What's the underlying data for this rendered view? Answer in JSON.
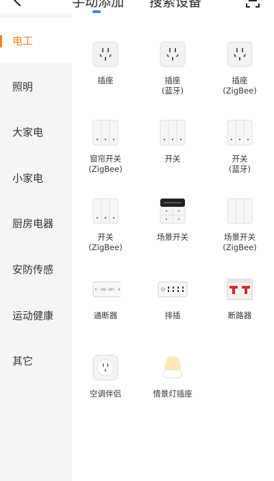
{
  "header": {
    "tabs": [
      {
        "label": "手动添加",
        "active": true
      },
      {
        "label": "搜索设备",
        "active": false
      }
    ],
    "accent_color": "#3b82f6"
  },
  "sidebar": {
    "active_color": "#f5821f",
    "items": [
      {
        "label": "电工",
        "active": true
      },
      {
        "label": "照明"
      },
      {
        "label": "大家电"
      },
      {
        "label": "小家电"
      },
      {
        "label": "厨房电器"
      },
      {
        "label": "安防传感"
      },
      {
        "label": "运动健康"
      },
      {
        "label": "其它"
      }
    ]
  },
  "devices": [
    {
      "line1": "插座",
      "line2": "",
      "icon": "socket-icon"
    },
    {
      "line1": "插座",
      "line2": "(蓝牙)",
      "icon": "socket-icon"
    },
    {
      "line1": "插座",
      "line2": "(ZigBee)",
      "icon": "socket-icon"
    },
    {
      "line1": "窗帘开关",
      "line2": "(ZigBee)",
      "icon": "curtain-switch-icon"
    },
    {
      "line1": "开关",
      "line2": "",
      "icon": "switch-icon"
    },
    {
      "line1": "开关",
      "line2": "(蓝牙)",
      "icon": "switch-icon"
    },
    {
      "line1": "开关",
      "line2": "(ZigBee)",
      "icon": "switch-icon"
    },
    {
      "line1": "场景开关",
      "line2": "",
      "icon": "scene-switch-icon"
    },
    {
      "line1": "场景开关",
      "line2": "(ZigBee)",
      "icon": "scene-switch-icon"
    },
    {
      "line1": "通断器",
      "line2": "",
      "icon": "relay-icon",
      "icon_text": "ON · OFF"
    },
    {
      "line1": "排插",
      "line2": "",
      "icon": "power-strip-icon"
    },
    {
      "line1": "断路器",
      "line2": "",
      "icon": "circuit-breaker-icon"
    },
    {
      "line1": "空调伴侣",
      "line2": "",
      "icon": "ac-companion-icon"
    },
    {
      "line1": "情景灯插座",
      "line2": "",
      "icon": "night-light-socket-icon"
    }
  ]
}
